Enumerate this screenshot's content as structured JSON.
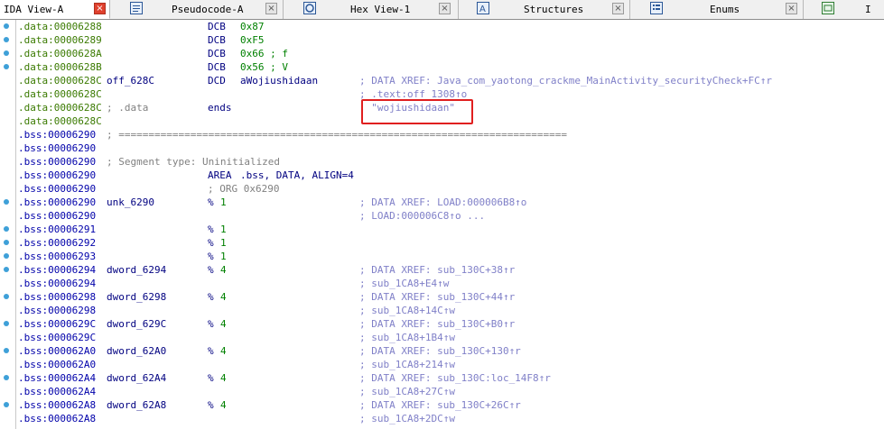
{
  "tabs": [
    {
      "label": "IDA View-A",
      "icon": "ida-view-icon",
      "active": true
    },
    {
      "label": "Pseudocode-A",
      "icon": "pseudocode-icon"
    },
    {
      "label": "Hex View-1",
      "icon": "hex-view-icon"
    },
    {
      "label": "Structures",
      "icon": "structures-icon"
    },
    {
      "label": "Enums",
      "icon": "enums-icon"
    },
    {
      "label": "I",
      "icon": "imports-icon"
    }
  ],
  "close_glyph": "×",
  "lines": [
    {
      "addr": ".data:00006288",
      "name": "",
      "mn": "DCB",
      "op": "0x87",
      "cmt": "",
      "dot": true
    },
    {
      "addr": ".data:00006289",
      "name": "",
      "mn": "DCB",
      "op": "0xF5",
      "cmt": "",
      "dot": true
    },
    {
      "addr": ".data:0000628A",
      "name": "",
      "mn": "DCB",
      "op": "0x66 ; f",
      "cmt": "",
      "dot": true
    },
    {
      "addr": ".data:0000628B",
      "name": "",
      "mn": "DCB",
      "op": "0x56 ; V",
      "cmt": "",
      "dot": true
    },
    {
      "addr": ".data:0000628C",
      "name": "off_628C",
      "mn": "DCD",
      "op": "aWojiushidaan",
      "cmt": "; DATA XREF: Java_com_yaotong_crackme_MainActivity_securityCheck+FC↑r",
      "dot": false
    },
    {
      "addr": ".data:0000628C",
      "name": "",
      "mn": "",
      "op": "",
      "cmt": "; .text:off_1308↑o",
      "dot": false
    },
    {
      "addr": ".data:0000628C",
      "name": "; .data",
      "mn": "ends",
      "op": "",
      "cmt": "; \"wojiushidaan\"",
      "dot": false
    },
    {
      "addr": ".data:0000628C",
      "name": "",
      "mn": "",
      "op": "",
      "cmt": "",
      "dot": false
    },
    {
      "addr": ".bss:00006290",
      "name": "; ===========================================================================",
      "mn": "",
      "op": "",
      "cmt": "",
      "dot": false
    },
    {
      "addr": ".bss:00006290",
      "name": "",
      "mn": "",
      "op": "",
      "cmt": "",
      "dot": false
    },
    {
      "addr": ".bss:00006290",
      "name": "; Segment type: Uninitialized",
      "mn": "",
      "op": "",
      "cmt": "",
      "dot": false
    },
    {
      "addr": ".bss:00006290",
      "name": "",
      "mn": "AREA",
      "op": ".bss, DATA, ALIGN=4",
      "cmt": "",
      "dot": false
    },
    {
      "addr": ".bss:00006290",
      "name": "",
      "mn": "; ORG 0x6290",
      "op": "",
      "cmt": "",
      "dot": false
    },
    {
      "addr": ".bss:00006290",
      "name": "unk_6290",
      "mn": "%",
      "op": "1",
      "cmt": "; DATA XREF: LOAD:000006B8↑o",
      "dot": true
    },
    {
      "addr": ".bss:00006290",
      "name": "",
      "mn": "",
      "op": "",
      "cmt": "; LOAD:000006C8↑o ...",
      "dot": false
    },
    {
      "addr": ".bss:00006291",
      "name": "",
      "mn": "%",
      "op": "1",
      "cmt": "",
      "dot": true
    },
    {
      "addr": ".bss:00006292",
      "name": "",
      "mn": "%",
      "op": "1",
      "cmt": "",
      "dot": true
    },
    {
      "addr": ".bss:00006293",
      "name": "",
      "mn": "%",
      "op": "1",
      "cmt": "",
      "dot": true
    },
    {
      "addr": ".bss:00006294",
      "name": "dword_6294",
      "mn": "%",
      "op": "4",
      "cmt": "; DATA XREF: sub_130C+38↑r",
      "dot": true
    },
    {
      "addr": ".bss:00006294",
      "name": "",
      "mn": "",
      "op": "",
      "cmt": "; sub_1CA8+E4↑w",
      "dot": false
    },
    {
      "addr": ".bss:00006298",
      "name": "dword_6298",
      "mn": "%",
      "op": "4",
      "cmt": "; DATA XREF: sub_130C+44↑r",
      "dot": true
    },
    {
      "addr": ".bss:00006298",
      "name": "",
      "mn": "",
      "op": "",
      "cmt": "; sub_1CA8+14C↑w",
      "dot": false
    },
    {
      "addr": ".bss:0000629C",
      "name": "dword_629C",
      "mn": "%",
      "op": "4",
      "cmt": "; DATA XREF: sub_130C+B0↑r",
      "dot": true
    },
    {
      "addr": ".bss:0000629C",
      "name": "",
      "mn": "",
      "op": "",
      "cmt": "; sub_1CA8+1B4↑w",
      "dot": false
    },
    {
      "addr": ".bss:000062A0",
      "name": "dword_62A0",
      "mn": "%",
      "op": "4",
      "cmt": "; DATA XREF: sub_130C+130↑r",
      "dot": true
    },
    {
      "addr": ".bss:000062A0",
      "name": "",
      "mn": "",
      "op": "",
      "cmt": "; sub_1CA8+214↑w",
      "dot": false
    },
    {
      "addr": ".bss:000062A4",
      "name": "dword_62A4",
      "mn": "%",
      "op": "4",
      "cmt": "; DATA XREF: sub_130C:loc_14F8↑r",
      "dot": true
    },
    {
      "addr": ".bss:000062A4",
      "name": "",
      "mn": "",
      "op": "",
      "cmt": "; sub_1CA8+27C↑w",
      "dot": false
    },
    {
      "addr": ".bss:000062A8",
      "name": "dword_62A8",
      "mn": "%",
      "op": "4",
      "cmt": "; DATA XREF: sub_130C+26C↑r",
      "dot": true
    },
    {
      "addr": ".bss:000062A8",
      "name": "",
      "mn": "",
      "op": "",
      "cmt": "; sub_1CA8+2DC↑w",
      "dot": false
    }
  ]
}
